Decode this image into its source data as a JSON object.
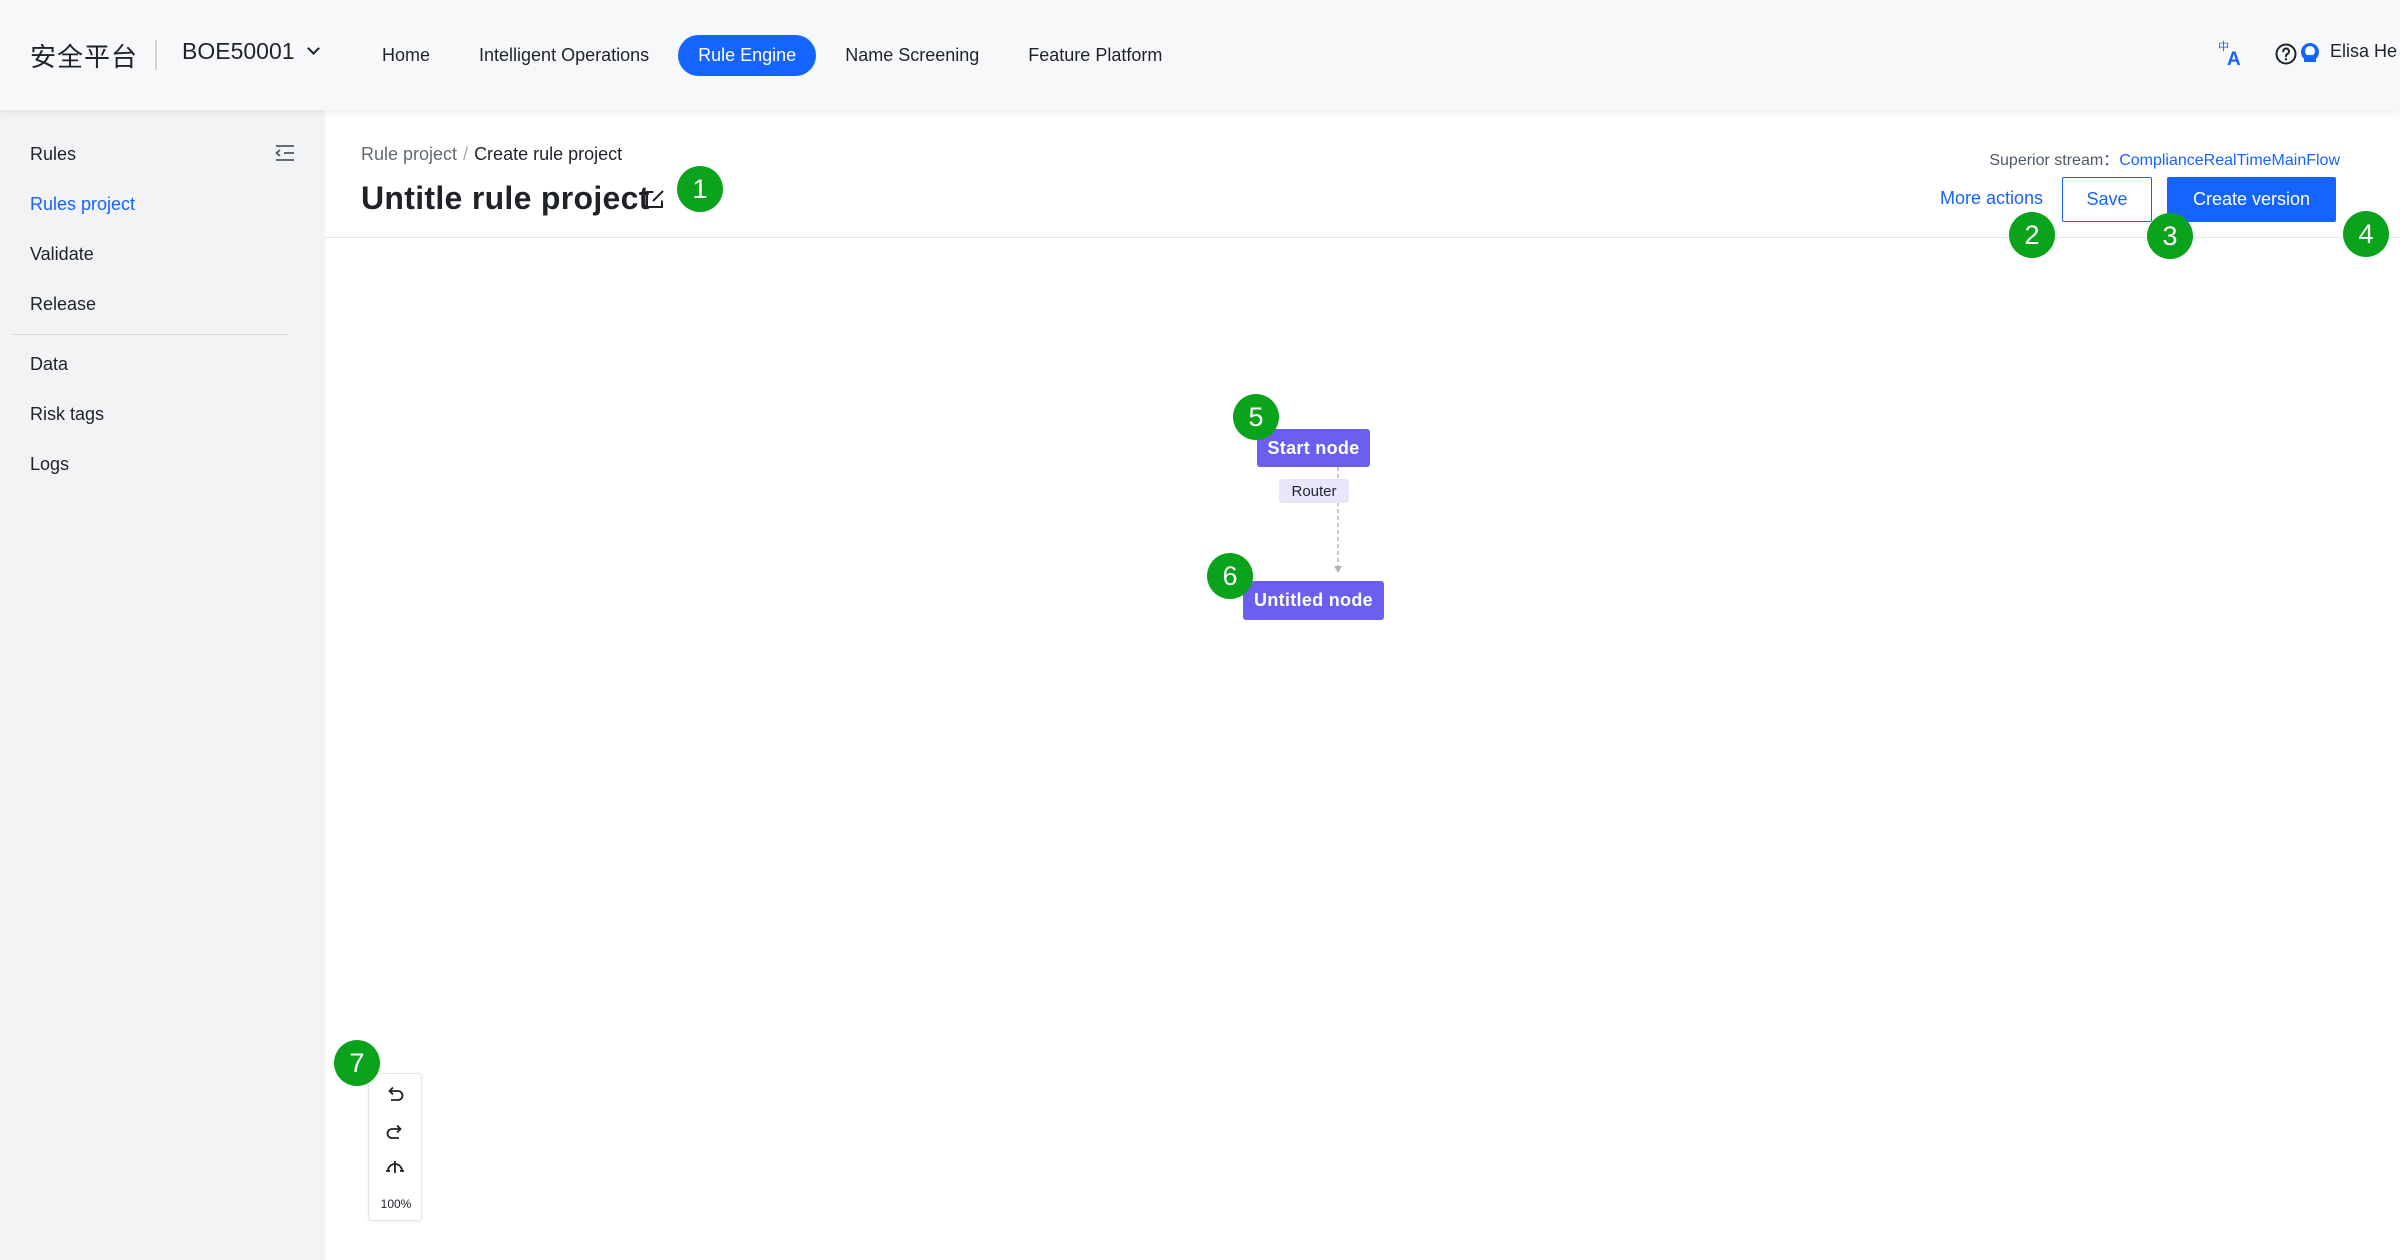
{
  "header": {
    "brand": "安全平台",
    "tenant": "BOE50001",
    "nav": [
      {
        "label": "Home"
      },
      {
        "label": "Intelligent Operations"
      },
      {
        "label": "Rule Engine"
      },
      {
        "label": "Name Screening"
      },
      {
        "label": "Feature Platform"
      }
    ],
    "active_nav": "Rule Engine",
    "user_name": "Elisa He",
    "accent_color": "#1664ff"
  },
  "sidebar": {
    "items": [
      {
        "label": "Rules"
      },
      {
        "label": "Rules project"
      },
      {
        "label": "Validate"
      },
      {
        "label": "Release"
      },
      {
        "label": "Data"
      },
      {
        "label": "Risk tags"
      },
      {
        "label": "Logs"
      }
    ],
    "active_item": "Rules project"
  },
  "page": {
    "breadcrumb_parent": "Rule project",
    "breadcrumb_sep": "/",
    "breadcrumb_current": "Create rule project",
    "title": "Untitle rule project",
    "superior_stream_label": "Superior stream：",
    "superior_stream_value": "ComplianceRealTimeMainFlow",
    "more_actions": "More actions",
    "save": "Save",
    "create_version": "Create version"
  },
  "canvas": {
    "start_node": "Start node",
    "router": "Router",
    "untitled_node": "Untitled node",
    "node_color": "#6b5ff2",
    "zoom": "100%"
  },
  "markers": [
    "1",
    "2",
    "3",
    "4",
    "5",
    "6",
    "7"
  ],
  "marker_color": "#0ba21c"
}
